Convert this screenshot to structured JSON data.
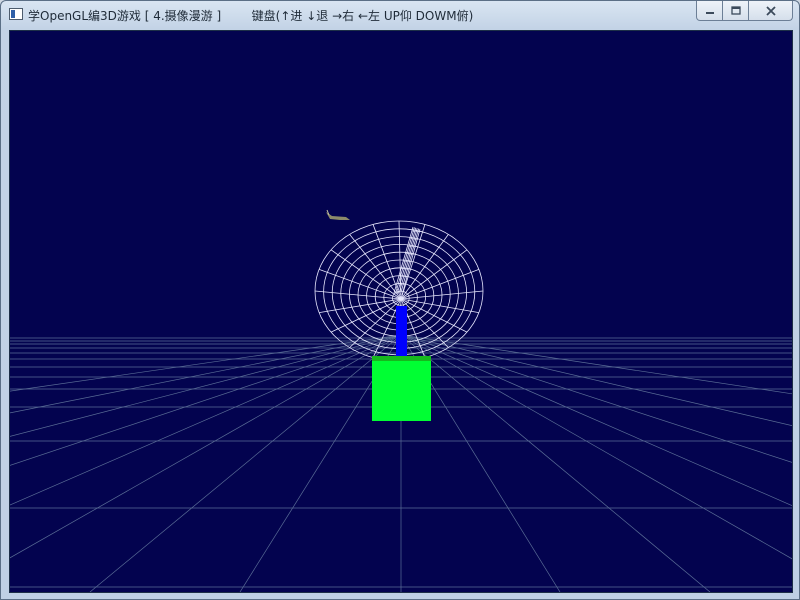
{
  "window": {
    "title": "学OpenGL编3D游戏 [ 4.摄像漫游 ]        键盘(↑进 ↓退 →右 ←左 UP仰 DOWM俯)"
  },
  "title_controls": {
    "minimize_icon": "minimize-icon",
    "maximize_icon": "maximize-icon",
    "close_icon": "close-icon"
  },
  "scene": {
    "background_color": "#03034f",
    "grid_color": "#5a6d96",
    "dish_color": "#e8e8ff",
    "pole_color": "#0000ff",
    "cube_color": "#00ff33",
    "cube_top_color": "#16b81e"
  }
}
